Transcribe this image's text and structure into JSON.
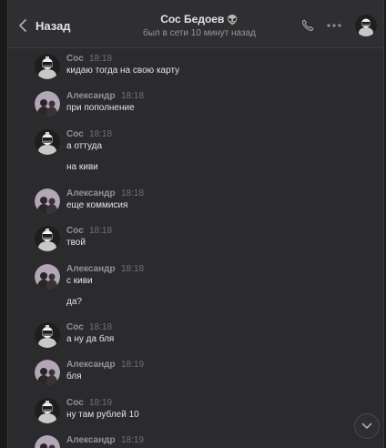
{
  "header": {
    "back_label": "Назад",
    "title": "Сос Бедоев",
    "title_emoji": "👽",
    "status": "был в сети 10 минут назад"
  },
  "messages": [
    {
      "author": "Сос",
      "time": "18:18",
      "lines": [
        "кидаю тогда на свою карту"
      ]
    },
    {
      "author": "Александр",
      "time": "18:18",
      "lines": [
        "при пополнение"
      ]
    },
    {
      "author": "Сос",
      "time": "18:18",
      "lines": [
        "а оттуда",
        "на киви"
      ]
    },
    {
      "author": "Александр",
      "time": "18:18",
      "lines": [
        "еще коммисия"
      ]
    },
    {
      "author": "Сос",
      "time": "18:18",
      "lines": [
        "твой"
      ]
    },
    {
      "author": "Александр",
      "time": "18:18",
      "lines": [
        "с киви",
        "да?"
      ]
    },
    {
      "author": "Сос",
      "time": "18:18",
      "lines": [
        "а ну да бля"
      ]
    },
    {
      "author": "Александр",
      "time": "18:19",
      "lines": [
        "бля"
      ]
    },
    {
      "author": "Сос",
      "time": "18:19",
      "lines": [
        "ну там рублей 10"
      ]
    },
    {
      "author": "Александр",
      "time": "18:19",
      "lines": []
    }
  ],
  "colors": {
    "background": "#2b2b2d",
    "header": "#2f2f31",
    "text": "#e1e3e6",
    "author": "#8f9499",
    "time": "#6e7175",
    "sos_avatar": "#1e1e20",
    "aleksandr_avatar": "#b3a6b6"
  },
  "icons": {
    "back": "chevron-left-icon",
    "call": "phone-icon",
    "menu": "more-horizontal-icon",
    "scroll": "chevron-down-icon"
  }
}
